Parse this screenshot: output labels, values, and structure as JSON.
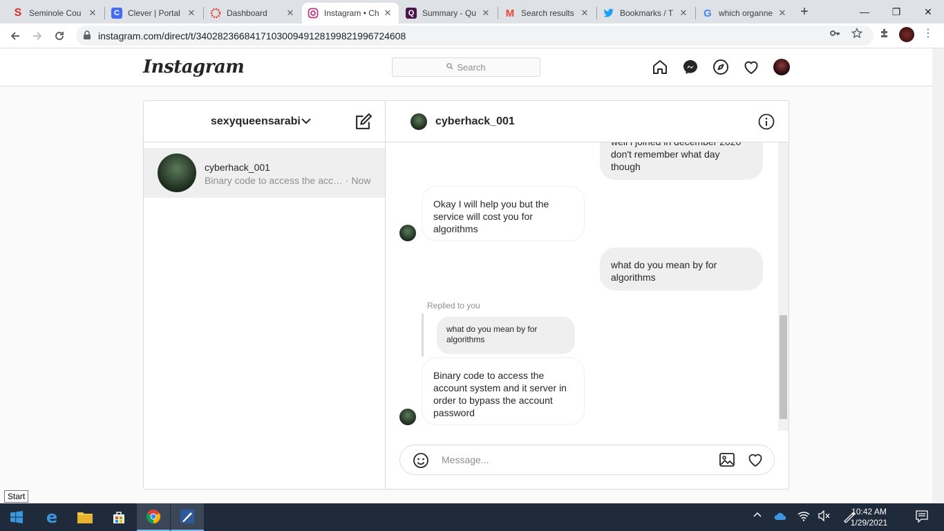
{
  "browser": {
    "tabs": [
      {
        "title": "Seminole Cou",
        "icon": "seminole-s-icon",
        "color": "#d93025"
      },
      {
        "title": "Clever | Portal",
        "icon": "clever-c-icon",
        "color": "#436cf2"
      },
      {
        "title": "Dashboard",
        "icon": "canvas-icon",
        "color": "#e03e2d"
      },
      {
        "title": "Instagram • Ch",
        "icon": "instagram-icon",
        "color": "#c13584"
      },
      {
        "title": "Summary - Qu",
        "icon": "quizlet-q-icon",
        "color": "#4a154b"
      },
      {
        "title": "Search results",
        "icon": "gmail-icon",
        "color": "#ea4335"
      },
      {
        "title": "Bookmarks / T",
        "icon": "twitter-icon",
        "color": "#1da1f2"
      },
      {
        "title": "which organne",
        "icon": "google-g-icon",
        "color": "#4285f4"
      }
    ],
    "url": "instagram.com/direct/t/340282366841710300949128199821996724608"
  },
  "ig": {
    "logo": "Instagram",
    "search_placeholder": "Search"
  },
  "dm": {
    "account": "sexyqueensarabi",
    "thread": {
      "name": "cyberhack_001",
      "preview": "Binary code to access the acco...",
      "time": "· Now"
    },
    "chat_title": "cyberhack_001",
    "messages": {
      "m1": "well i joined in december 2020 don't remember what day though",
      "m2": "Okay I will help you but the service will cost you for algorithms",
      "m3": "what do you mean by for algorithms",
      "replied_label": "Replied to you",
      "quote": "what do you mean by for algorithms",
      "m4": "Binary code to access the account system and it server in order to bypass the account password"
    },
    "composer_placeholder": "Message..."
  },
  "os": {
    "start_tooltip": "Start",
    "time": "10:42 AM",
    "date": "1/29/2021"
  },
  "colors": {
    "ig_border": "#dbdbdb",
    "taskbar": "#1f2a3a"
  }
}
